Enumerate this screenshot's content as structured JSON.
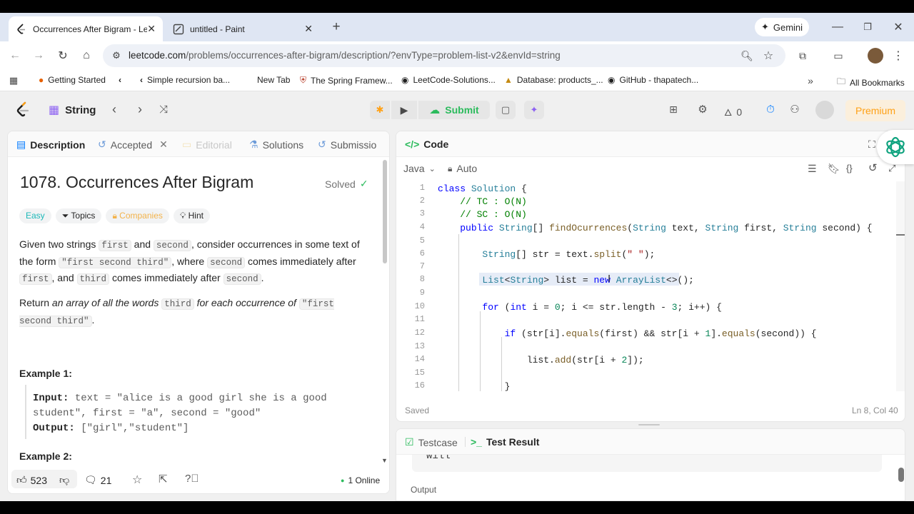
{
  "browser": {
    "tabs": [
      {
        "title": "Occurrences After Bigram - Lee",
        "active": true
      },
      {
        "title": "untitled - Paint",
        "active": false
      }
    ],
    "gemini_label": "Gemini",
    "url_host": "leetcode.com",
    "url_path": "/problems/occurrences-after-bigram/description/?envType=problem-list-v2&envId=string",
    "bookmarks": [
      "Getting Started",
      "Simple recursion ba...",
      "New Tab",
      "The Spring Framew...",
      "LeetCode-Solutions...",
      "Database: products_...",
      "GitHub - thapatech..."
    ],
    "all_bookmarks": "All Bookmarks"
  },
  "nav": {
    "problem_list": "String",
    "submit_label": "Submit",
    "streak": "0",
    "premium_label": "Premium"
  },
  "left_panel": {
    "tabs": {
      "description": "Description",
      "accepted": "Accepted",
      "editorial": "Editorial",
      "solutions": "Solutions",
      "submissions": "Submissio"
    },
    "title": "1078. Occurrences After Bigram",
    "status": "Solved",
    "tags": {
      "difficulty": "Easy",
      "topics": "Topics",
      "companies": "Companies",
      "hint": "Hint"
    },
    "desc": {
      "p1_a": "Given two strings ",
      "c_first": "first",
      "p1_b": " and ",
      "c_second": "second",
      "p1_c": ", consider occurrences in some text of the form ",
      "c_form": "\"first second third\"",
      "p1_d": ", where ",
      "p1_e": " comes immediately after ",
      "p1_f": ", and ",
      "c_third": "third",
      "p1_g": " comes immediately after ",
      "p1_h": ".",
      "p2_a": "Return ",
      "p2_b": "an array of all the words",
      "p2_c": " for each occurrence of ",
      "p2_d": "."
    },
    "example1_title": "Example 1:",
    "example1": {
      "input_label": "Input:",
      "input_line1": " text = \"alice is a good girl she is a good",
      "input_line2": "student\", first = \"a\", second = \"good\"",
      "output_label": "Output:",
      "output_value": " [\"girl\",\"student\"]"
    },
    "example2_title": "Example 2:",
    "footer": {
      "likes": "523",
      "comments": "21",
      "online": "1 Online"
    }
  },
  "code_panel": {
    "title": "Code",
    "language": "Java",
    "mode": "Auto",
    "saved": "Saved",
    "cursor": "Ln 8, Col 40",
    "line_numbers": [
      "1",
      "2",
      "3",
      "4",
      "5",
      "6",
      "7",
      "8",
      "9",
      "10",
      "11",
      "12",
      "13",
      "14",
      "15",
      "16"
    ]
  },
  "test_panel": {
    "testcase_label": "Testcase",
    "result_label": "Test Result",
    "partial_text": "will",
    "output_label": "Output"
  },
  "colors": {
    "accent_orange": "#ffa116",
    "success_green": "#2cbb5d",
    "blue": "#007aff"
  }
}
